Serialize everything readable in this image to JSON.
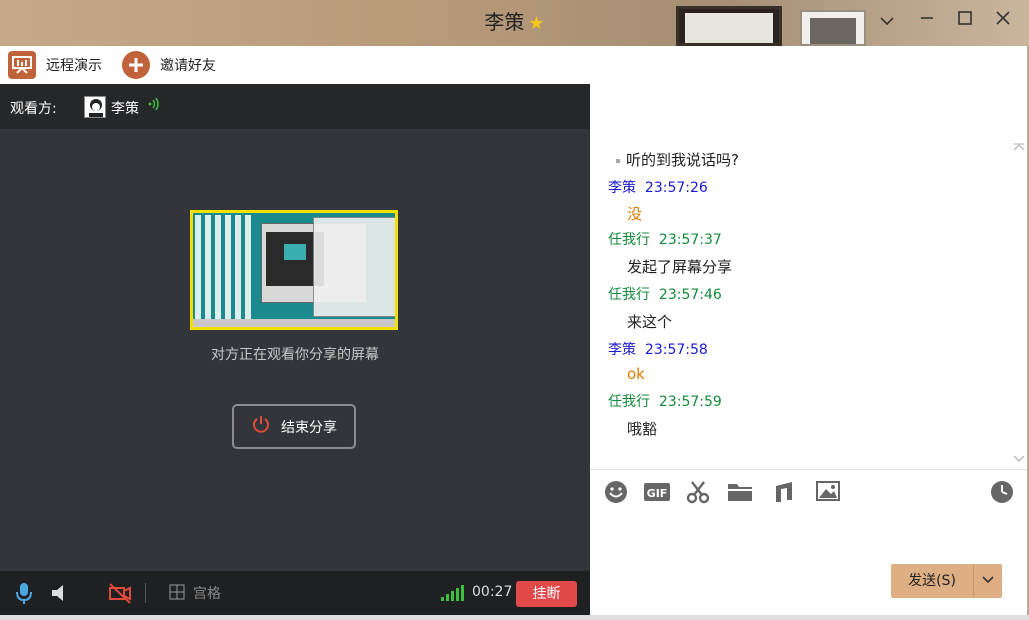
{
  "window": {
    "title": "李策",
    "title_badge": "star-badge-icon",
    "controls": [
      "chevron-down-icon",
      "minimize-icon",
      "maximize-icon",
      "close-icon"
    ]
  },
  "toolbar": {
    "remote_demo_label": "远程演示",
    "invite_label": "邀请好友"
  },
  "share": {
    "viewer_label": "观看方:",
    "viewer_name": "李策",
    "preview_caption": "对方正在观看你分享的屏幕",
    "end_share_label": "结束分享",
    "grid_label": "宫格",
    "timer": "00:27",
    "hangup_label": "挂断",
    "signal_level": 5
  },
  "chat": {
    "messages": [
      {
        "sender": "",
        "time": "",
        "text": "听的到我说话吗?",
        "color": "#222222"
      },
      {
        "sender": "李策",
        "time": "23:57:26",
        "text": "没",
        "color": "#e07a00"
      },
      {
        "sender": "任我行",
        "time": "23:57:37",
        "text": "发起了屏幕分享",
        "color": "#222222"
      },
      {
        "sender": "任我行",
        "time": "23:57:46",
        "text": "来这个",
        "color": "#222222"
      },
      {
        "sender": "李策",
        "time": "23:57:58",
        "text": "ok",
        "color": "#e07a00"
      },
      {
        "sender": "任我行",
        "time": "23:57:59",
        "text": "哦豁",
        "color": "#222222"
      }
    ],
    "sender_colors": {
      "李策": "#1a1ad0",
      "任我行": "#138a3a"
    },
    "tools": [
      "emoji-icon",
      "gif-icon",
      "scissors-icon",
      "folder-icon",
      "music-icon",
      "image-icon",
      "clock-icon"
    ],
    "send_label": "发送(S)"
  },
  "colors": {
    "accent": "#c0633a",
    "hangup": "#e24a4a",
    "send_button": "#deaf83",
    "preview_border": "#f4e000"
  }
}
